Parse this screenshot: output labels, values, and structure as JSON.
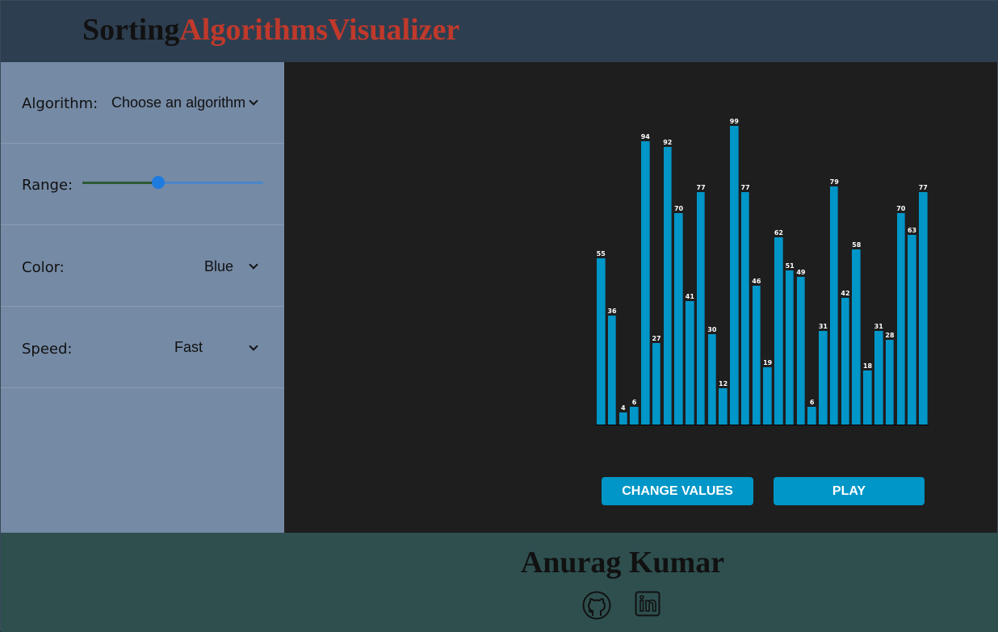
{
  "header": {
    "title_part1": "Sorting",
    "title_part2": "AlgorithmsVisualizer"
  },
  "sidebar": {
    "algorithm": {
      "label": "Algorithm:",
      "value": "Choose an algorithm"
    },
    "range": {
      "label": "Range:",
      "value_percent": 42
    },
    "color": {
      "label": "Color:",
      "value": "Blue"
    },
    "speed": {
      "label": "Speed:",
      "value": "Fast"
    }
  },
  "colors": {
    "bar": "#0096c7",
    "header": "#2d3e50",
    "sidebar": "#758aa5",
    "footer": "#2f4f4f",
    "accent_title": "#c0392b"
  },
  "chart_data": {
    "type": "bar",
    "values": [
      55,
      36,
      4,
      6,
      94,
      27,
      92,
      70,
      41,
      77,
      30,
      12,
      99,
      77,
      46,
      19,
      62,
      51,
      49,
      6,
      31,
      79,
      42,
      58,
      18,
      31,
      28,
      70,
      63,
      77
    ],
    "ylim": [
      0,
      99
    ]
  },
  "buttons": {
    "change_values": "CHANGE VALUES",
    "play": "PLAY"
  },
  "footer": {
    "author": "Anurag Kumar",
    "icons": [
      "github-icon",
      "linkedin-icon"
    ]
  }
}
